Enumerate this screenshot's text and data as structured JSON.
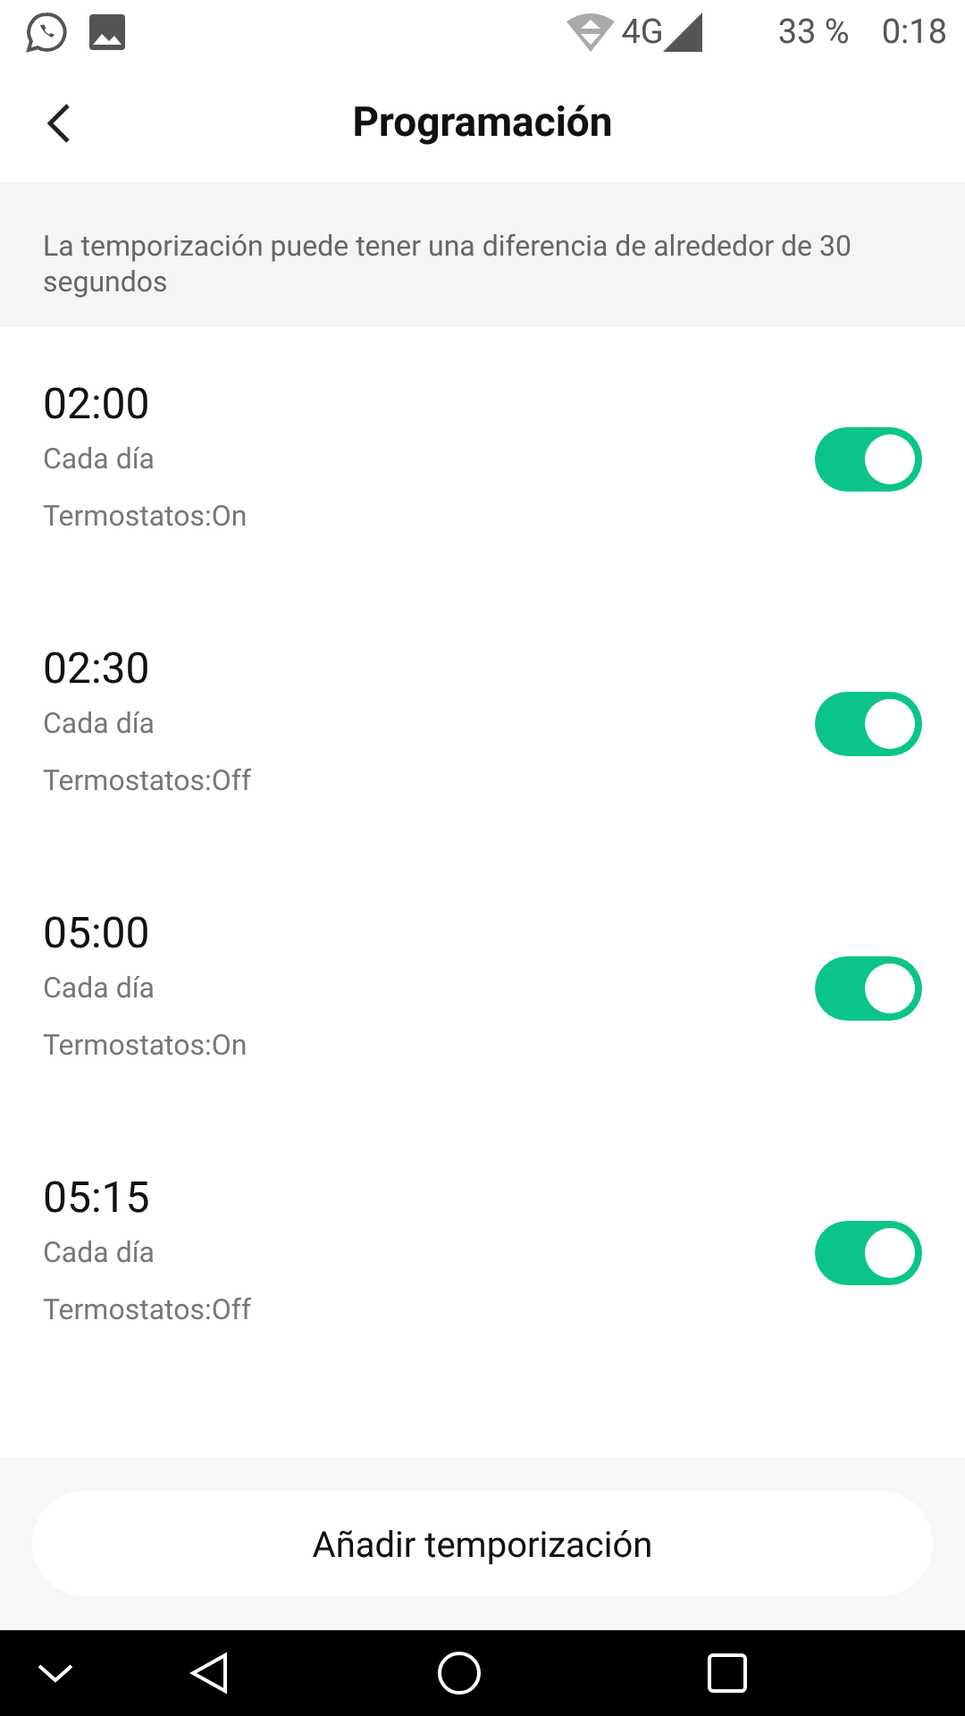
{
  "status_bar": {
    "battery": "33 %",
    "time": "0:18",
    "network": "4G"
  },
  "header": {
    "title": "Programación"
  },
  "notice": "La temporización puede tener una diferencia de alrededor de 30 segundos",
  "schedules": [
    {
      "time": "02:00",
      "repeat": "Cada día",
      "action": "Termostatos:On",
      "on": true
    },
    {
      "time": "02:30",
      "repeat": "Cada día",
      "action": "Termostatos:Off",
      "on": true
    },
    {
      "time": "05:00",
      "repeat": "Cada día",
      "action": "Termostatos:On",
      "on": true
    },
    {
      "time": "05:15",
      "repeat": "Cada día",
      "action": "Termostatos:Off",
      "on": true
    }
  ],
  "add_button": "Añadir temporización"
}
